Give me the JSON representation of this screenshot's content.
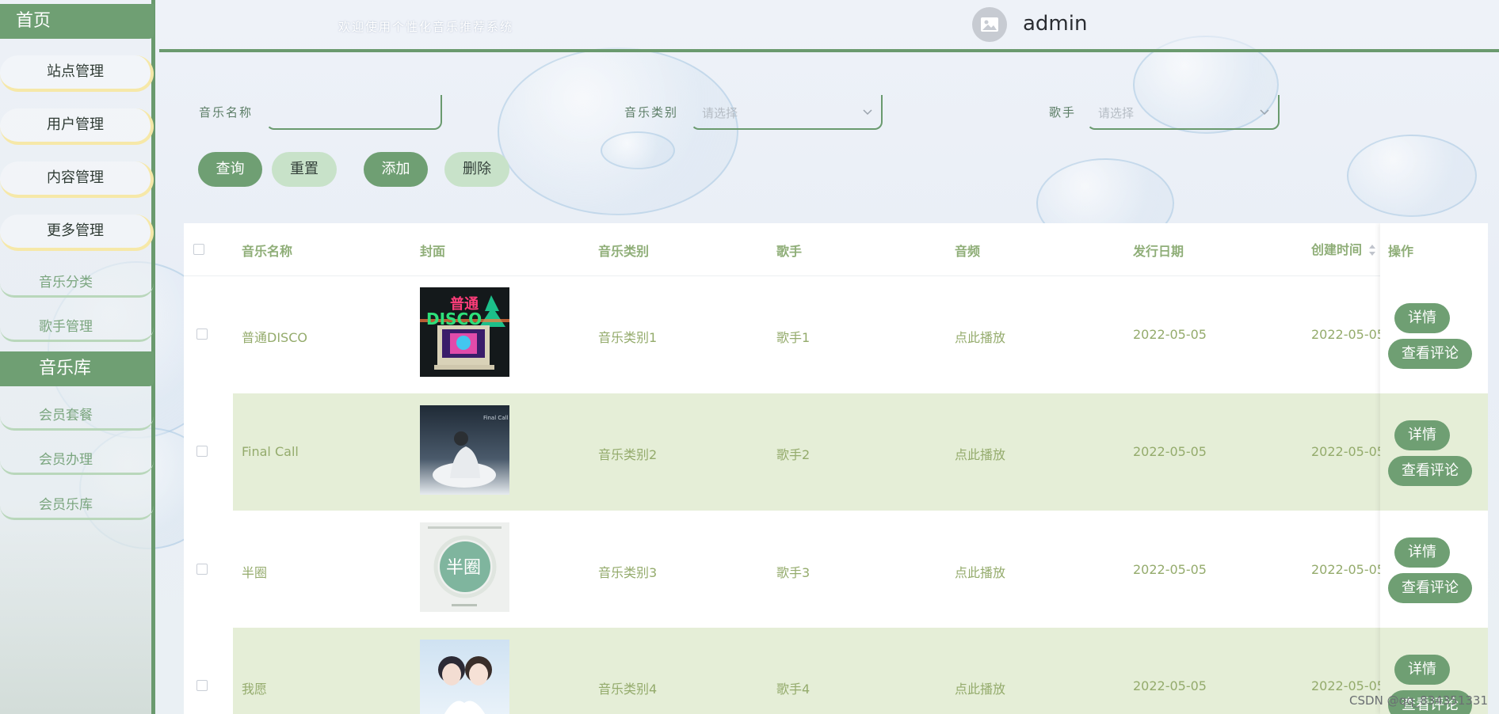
{
  "sidebar": {
    "home_label": "首页",
    "menu_pills": [
      "站点管理",
      "用户管理",
      "内容管理",
      "更多管理"
    ],
    "links_group1": [
      "音乐分类",
      "歌手管理"
    ],
    "section2_label": "音乐库",
    "links_group2": [
      "会员套餐",
      "会员办理",
      "会员乐库"
    ]
  },
  "header": {
    "welcome": "欢迎使用个性化音乐推荐系统",
    "username": "admin",
    "avatar_icon": "image-icon"
  },
  "search": {
    "name_label": "音乐名称",
    "name_value": "",
    "category_label": "音乐类别",
    "category_placeholder": "请选择",
    "singer_label": "歌手",
    "singer_placeholder": "请选择"
  },
  "actions": {
    "query": "查询",
    "reset": "重置",
    "add": "添加",
    "delete": "删除"
  },
  "table": {
    "headers": [
      "音乐名称",
      "封面",
      "音乐类别",
      "歌手",
      "音频",
      "发行日期",
      "创建时间",
      "操作"
    ],
    "rows": [
      {
        "name": "普通DISCO",
        "category": "音乐类别1",
        "singer": "歌手1",
        "audio": "点此播放",
        "release_date": "2022-05-05",
        "created": "2022-05-05"
      },
      {
        "name": "Final Call",
        "category": "音乐类别2",
        "singer": "歌手2",
        "audio": "点此播放",
        "release_date": "2022-05-05",
        "created": "2022-05-05"
      },
      {
        "name": "半圈",
        "category": "音乐类别3",
        "singer": "歌手3",
        "audio": "点此播放",
        "release_date": "2022-05-05",
        "created": "2022-05-05"
      },
      {
        "name": "我愿",
        "category": "音乐类别4",
        "singer": "歌手4",
        "audio": "点此播放",
        "release_date": "2022-05-05",
        "created": "2022-05-05"
      }
    ],
    "detail_label": "详情",
    "comment_label": "查看评论"
  },
  "cover_text": {
    "disco_title": "普通",
    "disco_sub": "DISCO",
    "final_call": "Final Call",
    "banquan": "半圈"
  },
  "watermark": "CSDN @qq_834351331",
  "colors": {
    "primary": "#6f9f73",
    "accent_light": "#c8e2c9",
    "row_alt": "#e5eed7",
    "cell_text": "#94ab6c"
  }
}
